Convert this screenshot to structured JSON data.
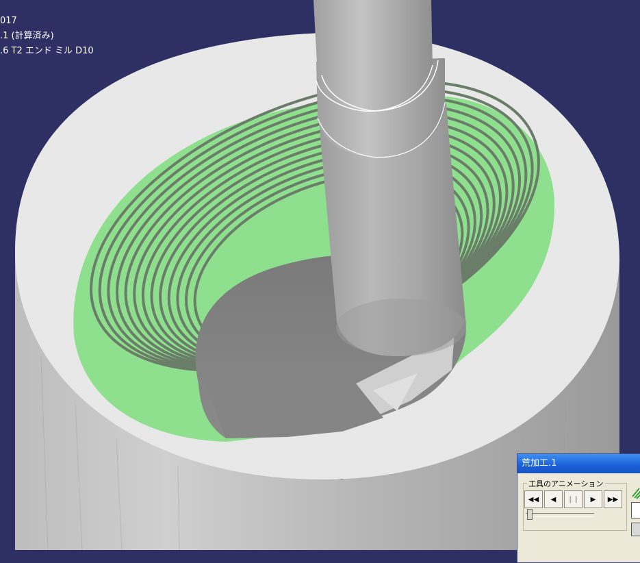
{
  "hud": {
    "line1": "017",
    "line2": ".1 (計算済み)",
    "line3": ".6  T2 エンド ミル D10"
  },
  "dialog": {
    "title": "荒加工.1",
    "group_label": "工具のアニメーション",
    "buttons": [
      {
        "name": "rewind-button",
        "glyph": "◀◀",
        "enabled": true
      },
      {
        "name": "step-back-button",
        "glyph": "◀",
        "enabled": true
      },
      {
        "name": "pause-button",
        "glyph": "❙❙",
        "enabled": false
      },
      {
        "name": "play-button",
        "glyph": "▶",
        "enabled": true
      },
      {
        "name": "fast-forward-button",
        "glyph": "▶▶",
        "enabled": true
      }
    ],
    "slider_position": 0.02
  },
  "colors": {
    "background": "#2e2f63",
    "stock": "#e6e6e6",
    "machined": "#8fe08e",
    "tool": "#a8a8a8"
  },
  "icons": [
    "rewind-icon",
    "step-back-icon",
    "pause-icon",
    "play-icon",
    "fast-forward-icon",
    "toolpath-icon",
    "video-icon"
  ]
}
